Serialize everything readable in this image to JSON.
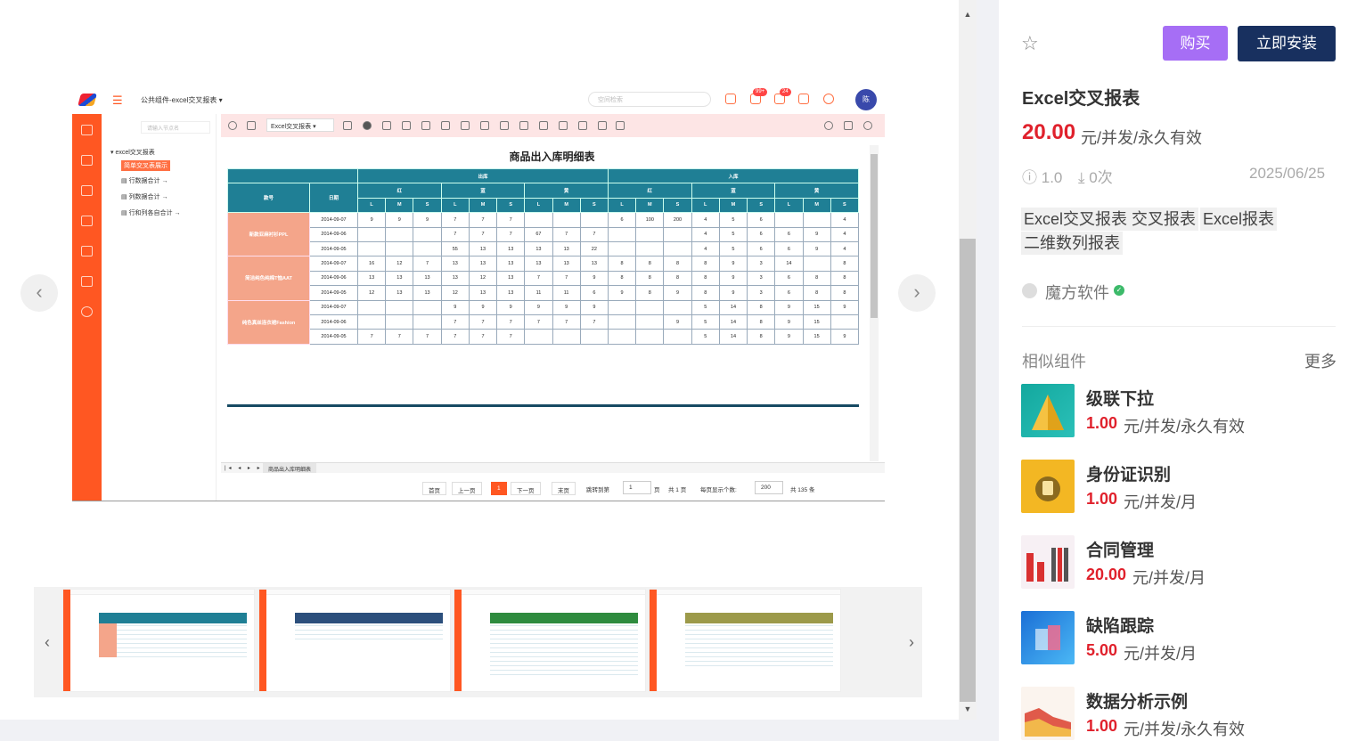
{
  "preview": {
    "app_title": "公共组件-excel交叉报表",
    "search_placeholder": "空间检索",
    "badge_1": "99+",
    "badge_2": "24",
    "user_avatar": "陈",
    "tree_search_placeholder": "请输入节点名",
    "tree_root": "excel交叉报表",
    "tree_items": [
      "简单交叉表展示",
      "行数据合计",
      "列数据合计",
      "行和列各自合计"
    ],
    "sheet_selector": "Excel交叉报表",
    "report_title": "商品出入库明细表",
    "header_groups": {
      "out": "出库",
      "in": "入库",
      "colors": [
        "红",
        "蓝",
        "黄"
      ],
      "sizes": [
        "L",
        "M",
        "S"
      ],
      "col_product": "款号",
      "col_date": "日期"
    },
    "products": [
      "新款亚麻衬衫PPL",
      "简洁纯色纯棉T恤AAT",
      "纯色真丝连衣裙Fashion"
    ],
    "dates": [
      "2014-09-07",
      "2014-09-06",
      "2014-09-05"
    ],
    "rows": [
      [
        "9",
        "9",
        "9",
        "7",
        "7",
        "7",
        "",
        "",
        "",
        "6",
        "100",
        "200",
        "4",
        "5",
        "6",
        "",
        "",
        "4"
      ],
      [
        "",
        "",
        "",
        "7",
        "7",
        "7",
        "67",
        "7",
        "7",
        "",
        "",
        "",
        "4",
        "5",
        "6",
        "6",
        "9",
        "4"
      ],
      [
        "",
        "",
        "",
        "55",
        "13",
        "13",
        "13",
        "13",
        "22",
        "",
        "",
        "",
        "4",
        "5",
        "6",
        "6",
        "9",
        "4"
      ],
      [
        "16",
        "12",
        "7",
        "13",
        "13",
        "13",
        "13",
        "13",
        "13",
        "8",
        "8",
        "8",
        "8",
        "9",
        "3",
        "14",
        "",
        "8"
      ],
      [
        "13",
        "13",
        "13",
        "13",
        "12",
        "13",
        "7",
        "7",
        "9",
        "8",
        "8",
        "8",
        "8",
        "9",
        "3",
        "6",
        "8",
        "8"
      ],
      [
        "12",
        "13",
        "13",
        "12",
        "13",
        "13",
        "11",
        "11",
        "6",
        "9",
        "8",
        "9",
        "8",
        "9",
        "3",
        "6",
        "8",
        "8"
      ],
      [
        "",
        "",
        "",
        "9",
        "9",
        "9",
        "9",
        "9",
        "9",
        "",
        "",
        "",
        "5",
        "14",
        "8",
        "9",
        "15",
        "9"
      ],
      [
        "",
        "",
        "",
        "7",
        "7",
        "7",
        "7",
        "7",
        "7",
        "",
        "",
        "9",
        "5",
        "14",
        "8",
        "9",
        "15",
        ""
      ],
      [
        "7",
        "7",
        "7",
        "7",
        "7",
        "7",
        "",
        "",
        "",
        "",
        "",
        "",
        "5",
        "14",
        "8",
        "9",
        "15",
        "9"
      ]
    ],
    "sheet_tab": "商品出入库明细表",
    "pager": {
      "first": "首页",
      "prev": "上一页",
      "current": "1",
      "next": "下一页",
      "last": "末页",
      "jump_label": "跳转到第",
      "jump_value": "1",
      "page_unit": "页",
      "total_pages": "共 1 页",
      "per_page_label": "每页显示个数:",
      "per_page_value": "200",
      "total_items": "共 135 条"
    }
  },
  "detail": {
    "buy_label": "购买",
    "install_label": "立即安装",
    "name": "Excel交叉报表",
    "price": "20.00",
    "price_unit": "元/并发/永久有效",
    "version": "1.0",
    "downloads": "0次",
    "date": "2025/06/25",
    "tags": [
      "Excel交叉报表",
      "交叉报表",
      "Excel报表",
      "二维数列报表"
    ],
    "author": "魔方软件",
    "similar_title": "相似组件",
    "more_label": "更多",
    "similar": [
      {
        "name": "级联下拉",
        "price": "1.00",
        "unit": "元/并发/永久有效"
      },
      {
        "name": "身份证识别",
        "price": "1.00",
        "unit": "元/并发/月"
      },
      {
        "name": "合同管理",
        "price": "20.00",
        "unit": "元/并发/月"
      },
      {
        "name": "缺陷跟踪",
        "price": "5.00",
        "unit": "元/并发/月"
      },
      {
        "name": "数据分析示例",
        "price": "1.00",
        "unit": "元/并发/永久有效"
      }
    ]
  },
  "colors": {
    "accent_orange": "#ff5722",
    "price_red": "#e0212c",
    "buy_purple": "#a66ef5",
    "install_navy": "#18305f",
    "table_header": "#1f7f95",
    "product_cell": "#f4a58a"
  }
}
